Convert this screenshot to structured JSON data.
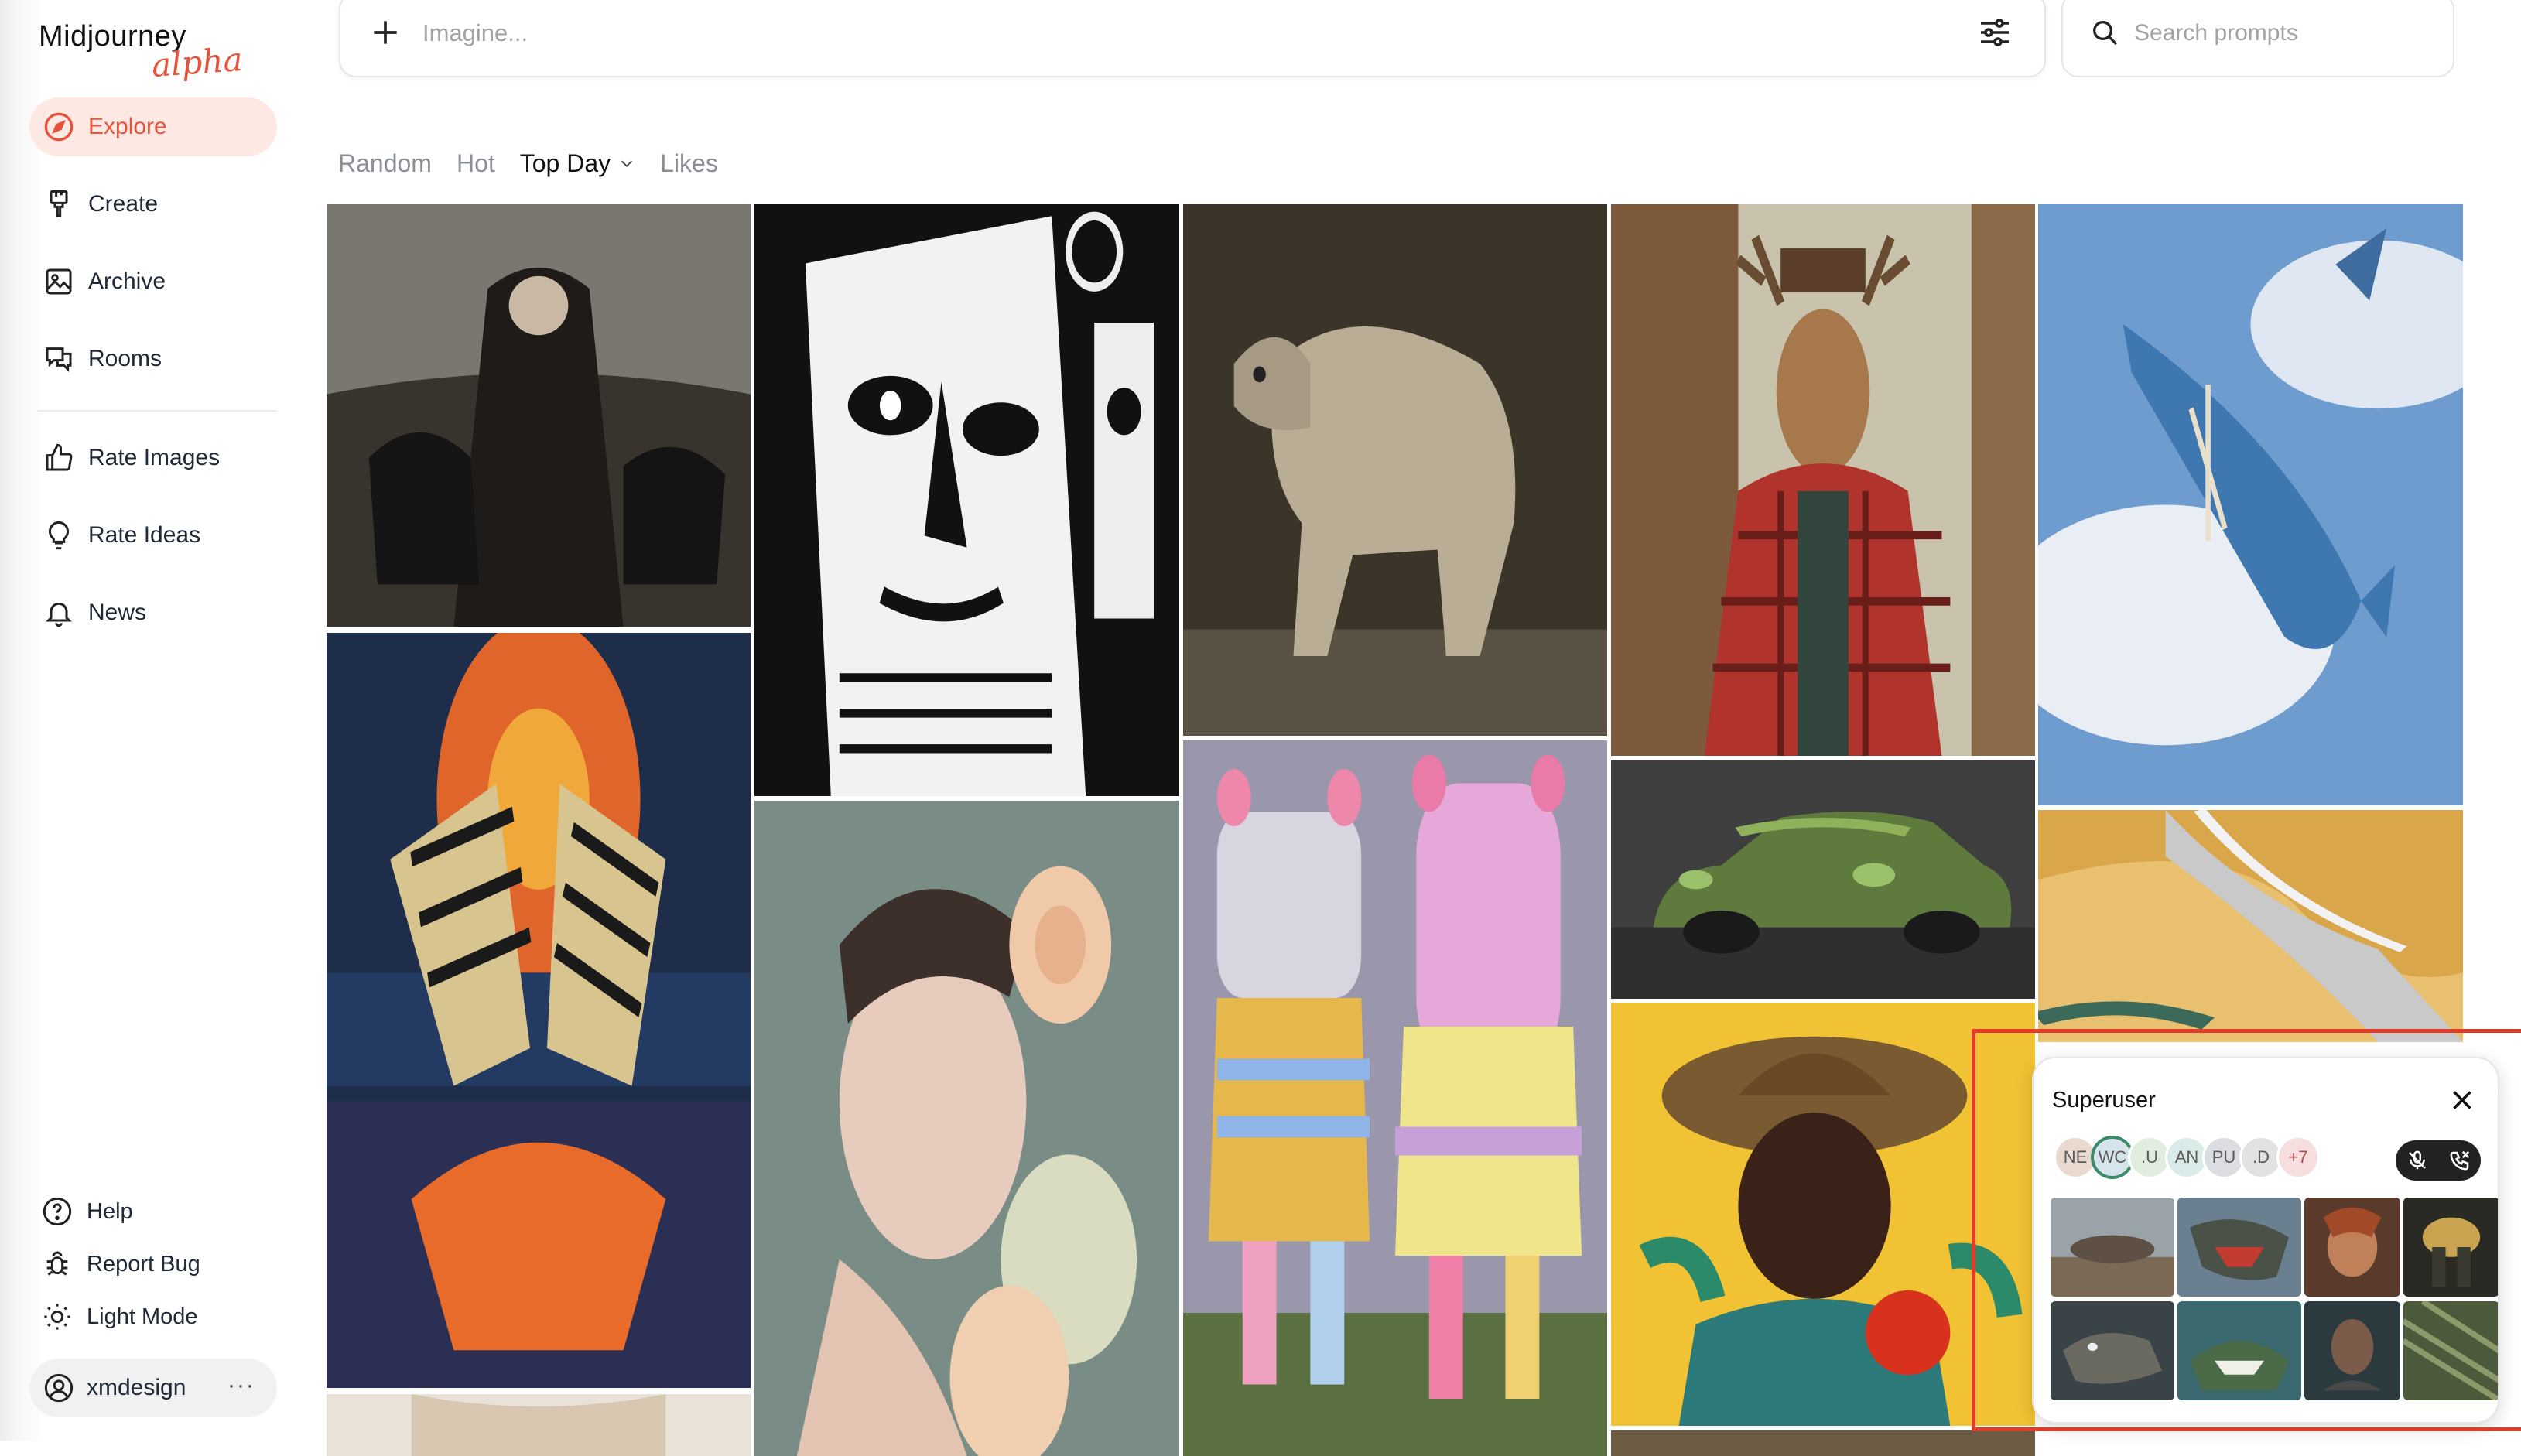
{
  "app": {
    "logo_main": "Midjourney",
    "logo_sub": "alpha",
    "accent_color": "#e5533d"
  },
  "sidebar": {
    "items": [
      {
        "label": "Explore",
        "icon": "compass-icon",
        "active": true
      },
      {
        "label": "Create",
        "icon": "paintbrush-icon"
      },
      {
        "label": "Archive",
        "icon": "image-icon"
      },
      {
        "label": "Rooms",
        "icon": "chat-bubbles-icon"
      },
      {
        "label": "Rate Images",
        "icon": "thumbs-up-icon"
      },
      {
        "label": "Rate Ideas",
        "icon": "lightbulb-icon"
      },
      {
        "label": "News",
        "icon": "bell-icon"
      }
    ],
    "footer": [
      {
        "label": "Help",
        "icon": "question-icon"
      },
      {
        "label": "Report Bug",
        "icon": "bug-icon"
      },
      {
        "label": "Light Mode",
        "icon": "sun-icon"
      }
    ],
    "user": {
      "name": "xmdesign",
      "more": "···"
    }
  },
  "imagine": {
    "placeholder": "Imagine..."
  },
  "search": {
    "placeholder": "Search prompts"
  },
  "tabs": [
    {
      "label": "Random"
    },
    {
      "label": "Hot"
    },
    {
      "label": "Top Day",
      "active": true
    },
    {
      "label": "Likes"
    }
  ],
  "room": {
    "title": "Superuser",
    "members": [
      {
        "initials": "NE",
        "color": "#ead9cf"
      },
      {
        "initials": "WC",
        "color": "#d6e4ec",
        "ring": true
      },
      {
        "initials": ".U",
        "color": "#e1eedf"
      },
      {
        "initials": "AN",
        "color": "#d9ece9"
      },
      {
        "initials": "PU",
        "color": "#dcdde2"
      },
      {
        "initials": ".D",
        "color": "#e2e2e2"
      },
      {
        "initials": "+7",
        "color": "#f6dede"
      }
    ]
  }
}
